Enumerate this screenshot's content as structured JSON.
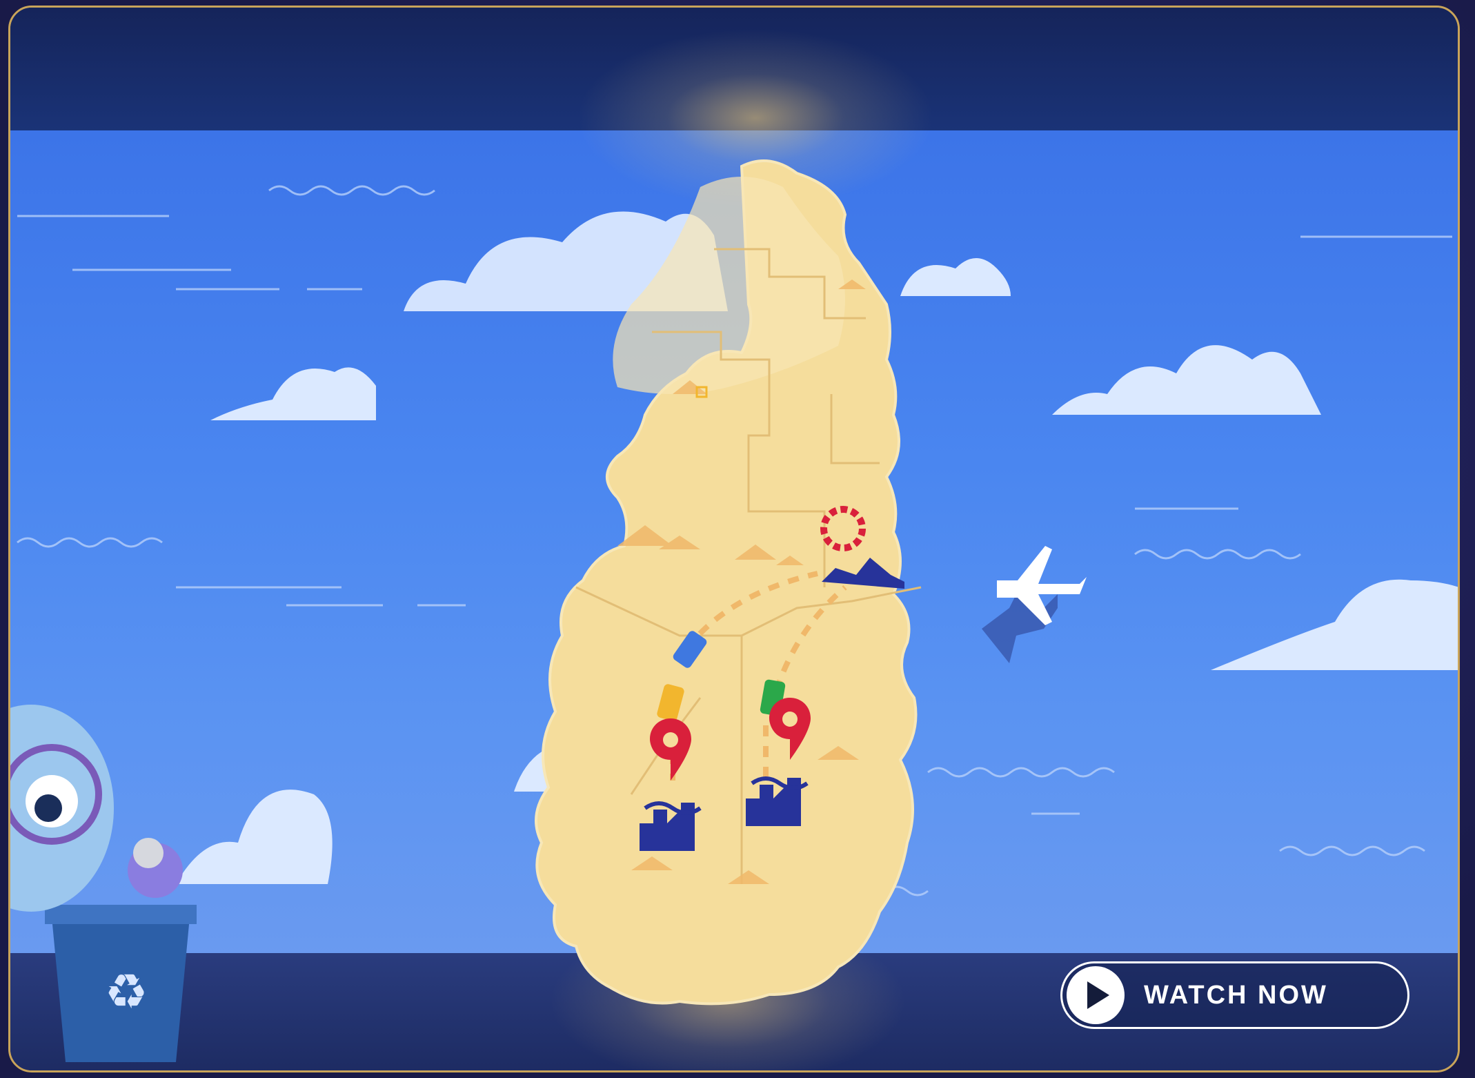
{
  "video": {
    "watch_button_label": "WATCH NOW"
  },
  "colors": {
    "frame_border": "#c9a45a",
    "sea": "#4a86f0",
    "land": "#f5dd9c",
    "pin": "#d9203b",
    "factory": "#27339a"
  },
  "icons": {
    "play": "play-icon",
    "recycle": "recycle-icon",
    "airplane": "airplane-icon"
  }
}
